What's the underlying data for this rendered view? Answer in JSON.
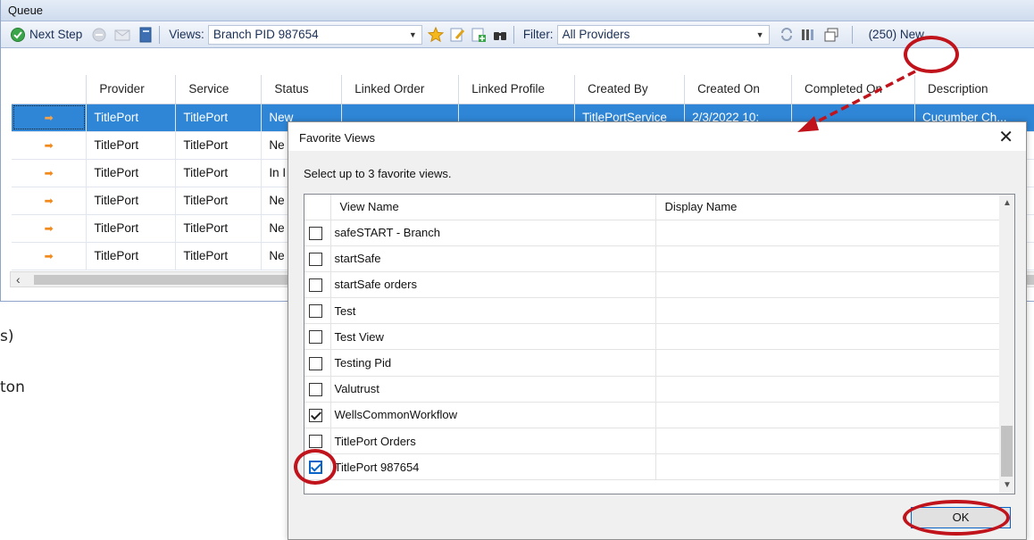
{
  "queue": {
    "title": "Queue",
    "toolbar": {
      "next_step_label": "Next Step",
      "views_label": "Views:",
      "views_value": "Branch PID 987654",
      "filter_label": "Filter:",
      "filter_value": "All Providers",
      "new_count_label": "(250) New"
    },
    "columns": [
      "",
      "Provider",
      "Service",
      "Status",
      "Linked Order",
      "Linked Profile",
      "Created By",
      "Created On",
      "Completed On",
      "Description"
    ],
    "rows": [
      {
        "provider": "TitlePort",
        "service": "TitlePort",
        "status": "New",
        "linked_order": "",
        "linked_profile": "",
        "created_by": "TitlePortService",
        "created_on": "2/3/2022 10:",
        "completed_on": "",
        "description": "Cucumber Ch..."
      },
      {
        "provider": "TitlePort",
        "service": "TitlePort",
        "status": "Ne",
        "linked_order": "",
        "linked_profile": "",
        "created_by": "",
        "created_on": "",
        "completed_on": "",
        "description": "..."
      },
      {
        "provider": "TitlePort",
        "service": "TitlePort",
        "status": "In I",
        "linked_order": "",
        "linked_profile": "",
        "created_by": "",
        "created_on": "",
        "completed_on": "",
        "description": "..."
      },
      {
        "provider": "TitlePort",
        "service": "TitlePort",
        "status": "Ne",
        "linked_order": "",
        "linked_profile": "",
        "created_by": "",
        "created_on": "",
        "completed_on": "",
        "description": "..."
      },
      {
        "provider": "TitlePort",
        "service": "TitlePort",
        "status": "Ne",
        "linked_order": "",
        "linked_profile": "",
        "created_by": "",
        "created_on": "",
        "completed_on": "",
        "description": "..."
      },
      {
        "provider": "TitlePort",
        "service": "TitlePort",
        "status": "Ne",
        "linked_order": "",
        "linked_profile": "",
        "created_by": "",
        "created_on": "",
        "completed_on": "",
        "description": "..."
      }
    ]
  },
  "background": {
    "line1": "s)",
    "line2": "ton"
  },
  "dialog": {
    "title": "Favorite Views",
    "hint": "Select up to 3 favorite views.",
    "col_view_name": "View Name",
    "col_display_name": "Display Name",
    "items": [
      {
        "name": "safeSTART - Branch",
        "checked": false
      },
      {
        "name": "startSafe",
        "checked": false
      },
      {
        "name": "startSafe orders",
        "checked": false
      },
      {
        "name": "Test",
        "checked": false
      },
      {
        "name": "Test View",
        "checked": false
      },
      {
        "name": "Testing Pid",
        "checked": false
      },
      {
        "name": "Valutrust",
        "checked": false
      },
      {
        "name": "WellsCommonWorkflow",
        "checked": true
      },
      {
        "name": "TitlePort Orders",
        "checked": false
      },
      {
        "name": "TitlePort 987654",
        "checked": true
      }
    ],
    "ok_label": "OK"
  },
  "colors": {
    "selection": "#2f86d6",
    "annotation": "#c0131b"
  }
}
